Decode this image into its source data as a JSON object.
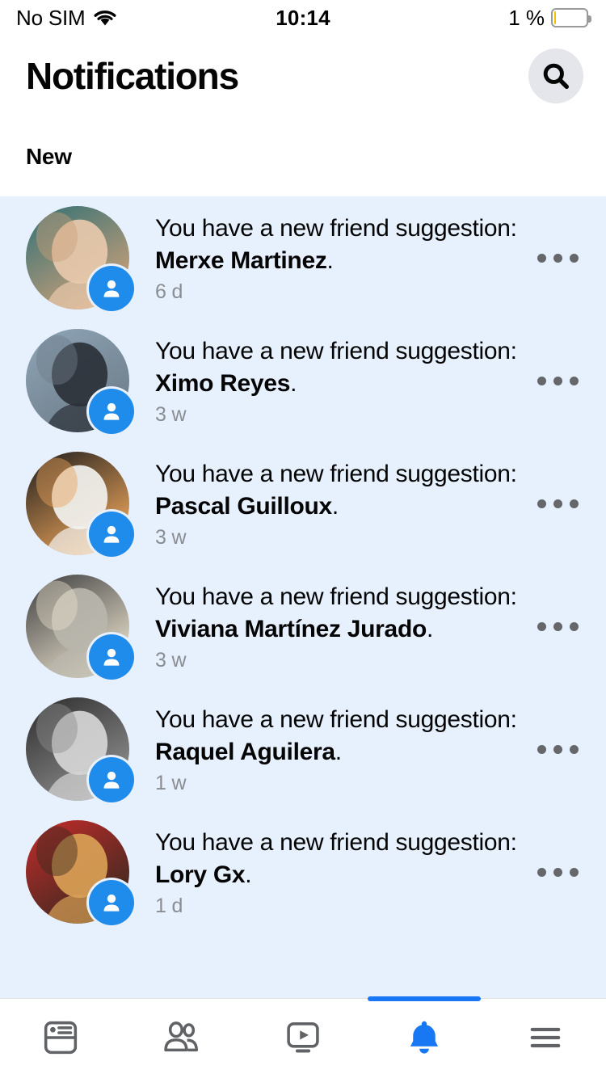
{
  "status_bar": {
    "carrier": "No SIM",
    "wifi_icon": "wifi-icon",
    "time": "10:14",
    "battery_percent": "1 %",
    "battery_level": 1,
    "battery_color": "#f2c200"
  },
  "header": {
    "title": "Notifications",
    "search_icon": "search-icon"
  },
  "section": {
    "title": "New",
    "background": "#e7f0fd"
  },
  "notifications": [
    {
      "prefix": "You have a new friend suggestion: ",
      "name": "Merxe Martinez",
      "suffix": ".",
      "time": "6 d",
      "badge_icon": "friend-request-icon",
      "avatar_name": "avatar-merxe-martinez",
      "avatar_colors": [
        "#2f6f74",
        "#c9a079",
        "#e8c9ad"
      ]
    },
    {
      "prefix": "You have a new friend suggestion: ",
      "name": "Ximo Reyes",
      "suffix": ".",
      "time": "3 w",
      "badge_icon": "friend-request-icon",
      "avatar_name": "avatar-ximo-reyes",
      "avatar_colors": [
        "#8fa6b8",
        "#6e7d8a",
        "#2b3138"
      ]
    },
    {
      "prefix": "You have a new friend suggestion: ",
      "name": "Pascal Guilloux",
      "suffix": ".",
      "time": "3 w",
      "badge_icon": "friend-request-icon",
      "avatar_name": "avatar-pascal-guilloux",
      "avatar_colors": [
        "#1b1b1b",
        "#e8a25a",
        "#f2f2ef"
      ]
    },
    {
      "prefix": "You have a new friend suggestion: ",
      "name": "Viviana Martínez Jurado",
      "suffix": ".",
      "time": "3 w",
      "badge_icon": "friend-request-icon",
      "avatar_name": "avatar-viviana-martinez-jurado",
      "avatar_colors": [
        "#3a3a3c",
        "#e4dcc8",
        "#b9b6ac"
      ]
    },
    {
      "prefix": "You have a new friend suggestion: ",
      "name": "Raquel Aguilera",
      "suffix": ".",
      "time": "1 w",
      "badge_icon": "friend-request-icon",
      "avatar_name": "avatar-raquel-aguilera",
      "avatar_colors": [
        "#2a2a2a",
        "#8d8d8d",
        "#d6d6d6"
      ]
    },
    {
      "prefix": "You have a new friend suggestion: ",
      "name": "Lory Gx",
      "suffix": ".",
      "time": "1 d",
      "badge_icon": "friend-request-icon",
      "avatar_name": "avatar-lory-gx",
      "avatar_colors": [
        "#c62b2b",
        "#3c2a20",
        "#d9a156"
      ]
    }
  ],
  "overflow_menu_icon": "ellipsis-icon",
  "bottom_nav": {
    "active_index": 3,
    "accent_color": "#1877f2",
    "items": [
      {
        "name": "news-feed-icon",
        "label": "News Feed",
        "active": false
      },
      {
        "name": "friends-icon",
        "label": "Friends",
        "active": false
      },
      {
        "name": "watch-video-icon",
        "label": "Watch",
        "active": false
      },
      {
        "name": "notifications-bell-icon",
        "label": "Notifications",
        "active": true
      },
      {
        "name": "menu-hamburger-icon",
        "label": "Menu",
        "active": false
      }
    ]
  }
}
